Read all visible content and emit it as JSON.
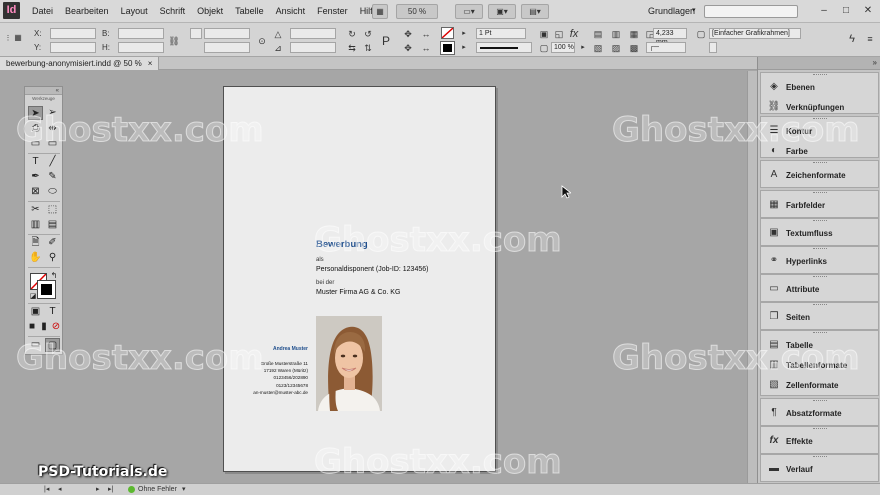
{
  "app": {
    "logo": "Id"
  },
  "menu": [
    "Datei",
    "Bearbeiten",
    "Layout",
    "Schrift",
    "Objekt",
    "Tabelle",
    "Ansicht",
    "Fenster",
    "Hilfe"
  ],
  "menubar": {
    "zoom": "50 %",
    "workspace": "Grundlagen"
  },
  "controlbar": {
    "x_label": "X:",
    "y_label": "Y:",
    "w_label": "B:",
    "h_label": "H:",
    "stroke_weight": "1 Pt",
    "percent": "100 %",
    "size_mm": "4,233 mm",
    "frame_style": "[Einfacher Grafikrahmen]"
  },
  "document": {
    "tab_title": "bewerbung-anonymisiert.indd @ 50 %",
    "close": "×"
  },
  "page_content": {
    "title": "Bewerbung",
    "als": "als",
    "position": "Personaldisponent (Job-ID: 123456)",
    "bei": "bei der",
    "company": "Muster Firma AG & Co. KG",
    "name": "Andrea Muster",
    "address": [
      "Große Musterstraße 11",
      "17192 Waren (Müritz)",
      "0123456/202890",
      "0123/12345678",
      "an-muster@muster-abc.de"
    ]
  },
  "toolpanel": {
    "close": "«",
    "label": "Werkzeuge"
  },
  "panels": [
    {
      "group": 1,
      "items": [
        {
          "label": "Ebenen",
          "icon": "layers-icon"
        },
        {
          "label": "Verknüpfungen",
          "icon": "links-icon"
        }
      ]
    },
    {
      "group": 2,
      "items": [
        {
          "label": "Kontur",
          "icon": "stroke-icon"
        },
        {
          "label": "Farbe",
          "icon": "color-icon"
        }
      ]
    },
    {
      "group": 3,
      "items": [
        {
          "label": "Zeichenformate",
          "icon": "character-styles-icon"
        }
      ]
    },
    {
      "group": 4,
      "items": [
        {
          "label": "Farbfelder",
          "icon": "swatches-icon"
        }
      ]
    },
    {
      "group": 5,
      "items": [
        {
          "label": "Textumfluss",
          "icon": "text-wrap-icon"
        }
      ]
    },
    {
      "group": 6,
      "items": [
        {
          "label": "Hyperlinks",
          "icon": "hyperlinks-icon"
        }
      ]
    },
    {
      "group": 7,
      "items": [
        {
          "label": "Attribute",
          "icon": "attributes-icon"
        }
      ]
    },
    {
      "group": 8,
      "items": [
        {
          "label": "Seiten",
          "icon": "pages-icon"
        }
      ]
    },
    {
      "group": 9,
      "items": [
        {
          "label": "Tabelle",
          "icon": "table-icon"
        },
        {
          "label": "Tabellenformate",
          "icon": "table-styles-icon"
        },
        {
          "label": "Zellenformate",
          "icon": "cell-styles-icon"
        }
      ]
    },
    {
      "group": 10,
      "items": [
        {
          "label": "Absatzformate",
          "icon": "paragraph-styles-icon"
        }
      ]
    },
    {
      "group": 11,
      "items": [
        {
          "label": "Effekte",
          "icon": "effects-icon"
        }
      ]
    },
    {
      "group": 12,
      "items": [
        {
          "label": "Verlauf",
          "icon": "gradient-icon"
        }
      ]
    }
  ],
  "statusbar": {
    "preflight": "Ohne Fehler"
  },
  "watermarks": {
    "main": "Ghostxx.com",
    "corner": "PSD-Tutorials.de"
  },
  "colors": {
    "accent_blue": "#1f4e8c",
    "preflight_ok": "#5cb830",
    "logo_pink": "#ff8cc1"
  }
}
